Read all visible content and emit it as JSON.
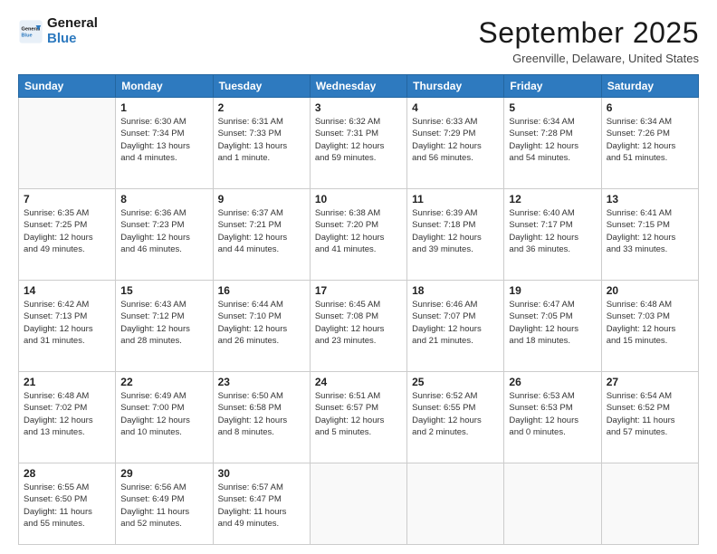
{
  "header": {
    "logo": {
      "general": "General",
      "blue": "Blue"
    },
    "title": "September 2025",
    "location": "Greenville, Delaware, United States"
  },
  "weekdays": [
    "Sunday",
    "Monday",
    "Tuesday",
    "Wednesday",
    "Thursday",
    "Friday",
    "Saturday"
  ],
  "weeks": [
    [
      {
        "day": "",
        "info": ""
      },
      {
        "day": "1",
        "info": "Sunrise: 6:30 AM\nSunset: 7:34 PM\nDaylight: 13 hours\nand 4 minutes."
      },
      {
        "day": "2",
        "info": "Sunrise: 6:31 AM\nSunset: 7:33 PM\nDaylight: 13 hours\nand 1 minute."
      },
      {
        "day": "3",
        "info": "Sunrise: 6:32 AM\nSunset: 7:31 PM\nDaylight: 12 hours\nand 59 minutes."
      },
      {
        "day": "4",
        "info": "Sunrise: 6:33 AM\nSunset: 7:29 PM\nDaylight: 12 hours\nand 56 minutes."
      },
      {
        "day": "5",
        "info": "Sunrise: 6:34 AM\nSunset: 7:28 PM\nDaylight: 12 hours\nand 54 minutes."
      },
      {
        "day": "6",
        "info": "Sunrise: 6:34 AM\nSunset: 7:26 PM\nDaylight: 12 hours\nand 51 minutes."
      }
    ],
    [
      {
        "day": "7",
        "info": "Sunrise: 6:35 AM\nSunset: 7:25 PM\nDaylight: 12 hours\nand 49 minutes."
      },
      {
        "day": "8",
        "info": "Sunrise: 6:36 AM\nSunset: 7:23 PM\nDaylight: 12 hours\nand 46 minutes."
      },
      {
        "day": "9",
        "info": "Sunrise: 6:37 AM\nSunset: 7:21 PM\nDaylight: 12 hours\nand 44 minutes."
      },
      {
        "day": "10",
        "info": "Sunrise: 6:38 AM\nSunset: 7:20 PM\nDaylight: 12 hours\nand 41 minutes."
      },
      {
        "day": "11",
        "info": "Sunrise: 6:39 AM\nSunset: 7:18 PM\nDaylight: 12 hours\nand 39 minutes."
      },
      {
        "day": "12",
        "info": "Sunrise: 6:40 AM\nSunset: 7:17 PM\nDaylight: 12 hours\nand 36 minutes."
      },
      {
        "day": "13",
        "info": "Sunrise: 6:41 AM\nSunset: 7:15 PM\nDaylight: 12 hours\nand 33 minutes."
      }
    ],
    [
      {
        "day": "14",
        "info": "Sunrise: 6:42 AM\nSunset: 7:13 PM\nDaylight: 12 hours\nand 31 minutes."
      },
      {
        "day": "15",
        "info": "Sunrise: 6:43 AM\nSunset: 7:12 PM\nDaylight: 12 hours\nand 28 minutes."
      },
      {
        "day": "16",
        "info": "Sunrise: 6:44 AM\nSunset: 7:10 PM\nDaylight: 12 hours\nand 26 minutes."
      },
      {
        "day": "17",
        "info": "Sunrise: 6:45 AM\nSunset: 7:08 PM\nDaylight: 12 hours\nand 23 minutes."
      },
      {
        "day": "18",
        "info": "Sunrise: 6:46 AM\nSunset: 7:07 PM\nDaylight: 12 hours\nand 21 minutes."
      },
      {
        "day": "19",
        "info": "Sunrise: 6:47 AM\nSunset: 7:05 PM\nDaylight: 12 hours\nand 18 minutes."
      },
      {
        "day": "20",
        "info": "Sunrise: 6:48 AM\nSunset: 7:03 PM\nDaylight: 12 hours\nand 15 minutes."
      }
    ],
    [
      {
        "day": "21",
        "info": "Sunrise: 6:48 AM\nSunset: 7:02 PM\nDaylight: 12 hours\nand 13 minutes."
      },
      {
        "day": "22",
        "info": "Sunrise: 6:49 AM\nSunset: 7:00 PM\nDaylight: 12 hours\nand 10 minutes."
      },
      {
        "day": "23",
        "info": "Sunrise: 6:50 AM\nSunset: 6:58 PM\nDaylight: 12 hours\nand 8 minutes."
      },
      {
        "day": "24",
        "info": "Sunrise: 6:51 AM\nSunset: 6:57 PM\nDaylight: 12 hours\nand 5 minutes."
      },
      {
        "day": "25",
        "info": "Sunrise: 6:52 AM\nSunset: 6:55 PM\nDaylight: 12 hours\nand 2 minutes."
      },
      {
        "day": "26",
        "info": "Sunrise: 6:53 AM\nSunset: 6:53 PM\nDaylight: 12 hours\nand 0 minutes."
      },
      {
        "day": "27",
        "info": "Sunrise: 6:54 AM\nSunset: 6:52 PM\nDaylight: 11 hours\nand 57 minutes."
      }
    ],
    [
      {
        "day": "28",
        "info": "Sunrise: 6:55 AM\nSunset: 6:50 PM\nDaylight: 11 hours\nand 55 minutes."
      },
      {
        "day": "29",
        "info": "Sunrise: 6:56 AM\nSunset: 6:49 PM\nDaylight: 11 hours\nand 52 minutes."
      },
      {
        "day": "30",
        "info": "Sunrise: 6:57 AM\nSunset: 6:47 PM\nDaylight: 11 hours\nand 49 minutes."
      },
      {
        "day": "",
        "info": ""
      },
      {
        "day": "",
        "info": ""
      },
      {
        "day": "",
        "info": ""
      },
      {
        "day": "",
        "info": ""
      }
    ]
  ]
}
